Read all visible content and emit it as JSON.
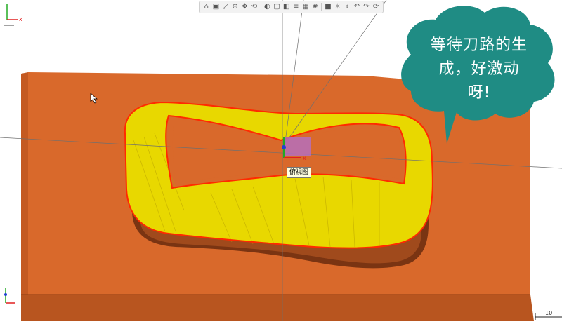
{
  "toolbar": {
    "buttons": [
      {
        "icon": "home-icon",
        "glyph": "⌂"
      },
      {
        "icon": "view-icon",
        "glyph": "▣"
      },
      {
        "icon": "fit-icon",
        "glyph": "⤢"
      },
      {
        "icon": "zoom-icon",
        "glyph": "⊕"
      },
      {
        "icon": "pan-icon",
        "glyph": "✥"
      },
      {
        "icon": "rotate-icon",
        "glyph": "⟲"
      },
      {
        "icon": "shade-icon",
        "glyph": "◐"
      },
      {
        "icon": "wire-icon",
        "glyph": "▢"
      },
      {
        "icon": "section-icon",
        "glyph": "◧"
      },
      {
        "icon": "layer-icon",
        "glyph": "≡"
      },
      {
        "icon": "display-icon",
        "glyph": "▦"
      },
      {
        "icon": "grid-icon",
        "glyph": "#"
      },
      {
        "icon": "color-icon",
        "glyph": "■"
      },
      {
        "icon": "light-icon",
        "glyph": "☼"
      },
      {
        "icon": "measure-icon",
        "glyph": "⌖"
      },
      {
        "icon": "undo-view-icon",
        "glyph": "↶"
      },
      {
        "icon": "redo-view-icon",
        "glyph": "↷"
      },
      {
        "icon": "refresh-icon",
        "glyph": "⟳"
      }
    ]
  },
  "callout": {
    "text": "等待刀路的生成，好激动呀!",
    "line1": "等待刀路的生",
    "line2": "成，好激动",
    "line3": "呀!",
    "color": "#1f8c84"
  },
  "tooltip": {
    "label": "俯视图"
  },
  "axes": {
    "top_left_x": "x",
    "center_x": "x"
  },
  "scale": {
    "label": "10"
  },
  "colors": {
    "block": "#d9692b",
    "toolpath": "#e8d800",
    "edge": "#ff2a00"
  }
}
